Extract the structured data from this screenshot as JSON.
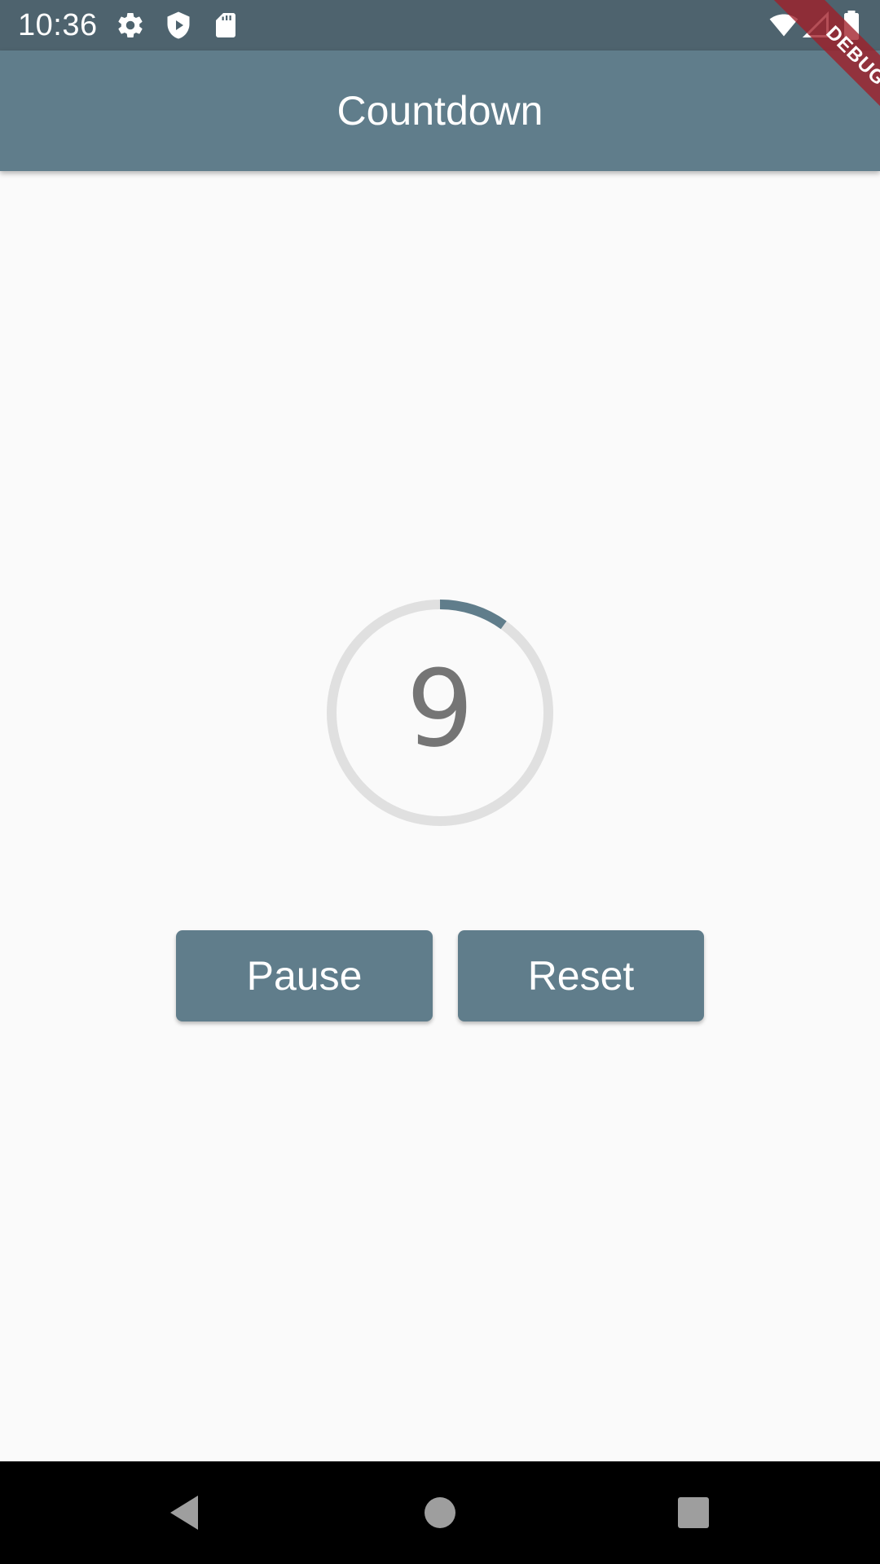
{
  "status_bar": {
    "time": "10:36",
    "icons": [
      "gear-icon",
      "shield-play-icon",
      "sd-card-icon",
      "wifi-icon",
      "cell-signal-icon",
      "battery-icon"
    ]
  },
  "debug_banner": {
    "label": "DEBUG"
  },
  "app_bar": {
    "title": "Countdown"
  },
  "countdown": {
    "value": "9",
    "progress_fraction": 0.1
  },
  "actions": {
    "pause_label": "Pause",
    "reset_label": "Reset"
  },
  "nav_bar": {
    "icons": [
      "back-icon",
      "home-icon",
      "recents-icon"
    ]
  },
  "colors": {
    "primary": "#607d8b",
    "status_bar": "#4e636e",
    "track": "#e0e0e0",
    "number": "#757575",
    "background": "#fafafa",
    "debug": "#a01e28"
  }
}
